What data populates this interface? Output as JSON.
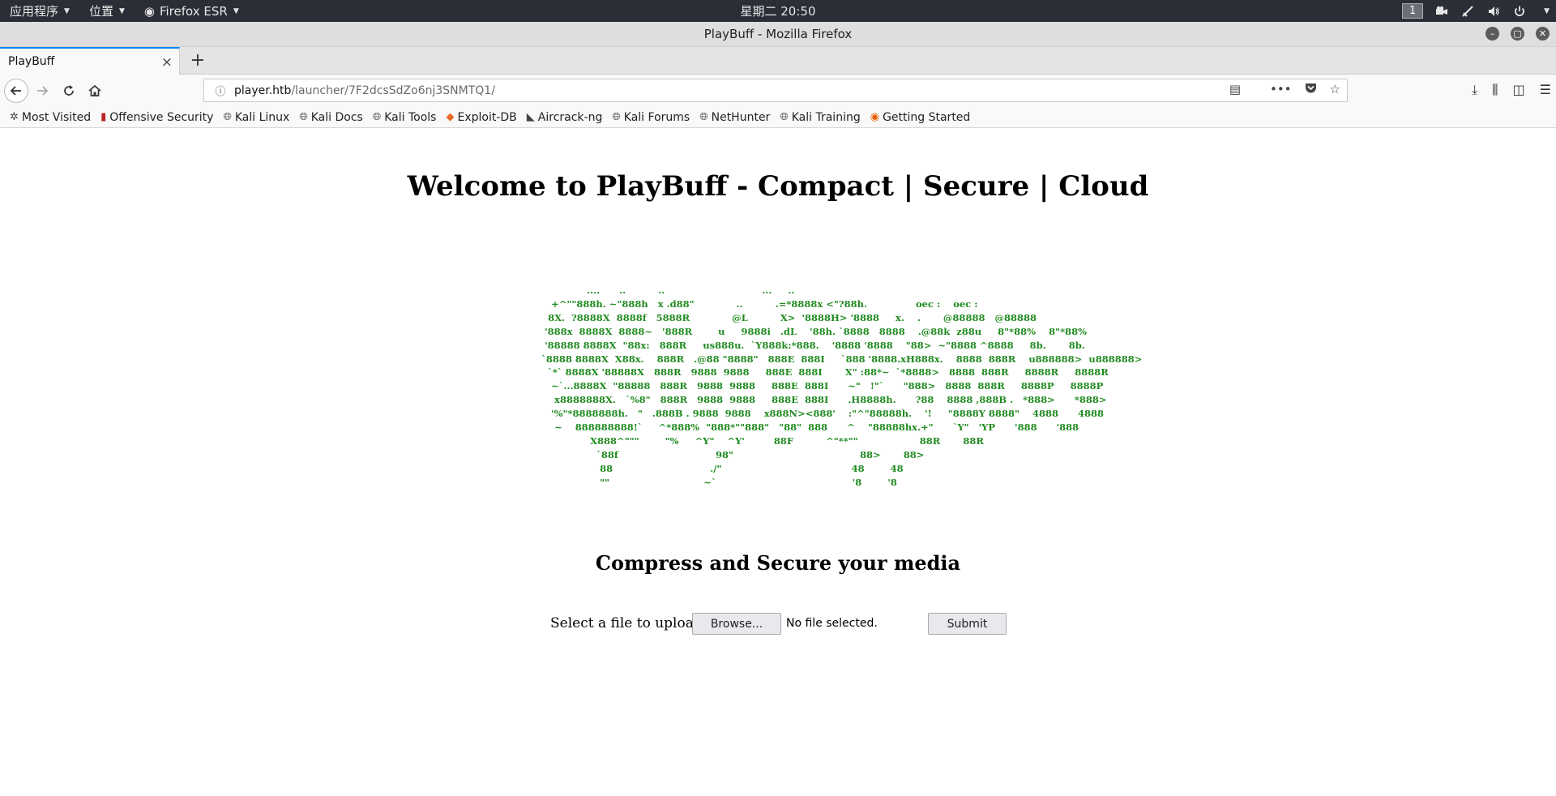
{
  "desktop": {
    "applications_label": "应用程序",
    "places_label": "位置",
    "active_app_label": "Firefox ESR",
    "clock": "星期二 20:50",
    "workspace_number": "1"
  },
  "window": {
    "title": "PlayBuff - Mozilla Firefox"
  },
  "tabs": [
    {
      "label": "PlayBuff",
      "active": true
    }
  ],
  "urlbar": {
    "host": "player.htb",
    "path": "/launcher/7F2dcsSdZo6nj3SNMTQ1/"
  },
  "bookmarks": [
    {
      "label": "Most Visited",
      "icon": "gear-icon"
    },
    {
      "label": "Offensive Security",
      "icon": "offsec-icon"
    },
    {
      "label": "Kali Linux",
      "icon": "globe-icon"
    },
    {
      "label": "Kali Docs",
      "icon": "globe-icon"
    },
    {
      "label": "Kali Tools",
      "icon": "globe-icon"
    },
    {
      "label": "Exploit-DB",
      "icon": "exploitdb-icon"
    },
    {
      "label": "Aircrack-ng",
      "icon": "aircrack-icon"
    },
    {
      "label": "Kali Forums",
      "icon": "globe-icon"
    },
    {
      "label": "NetHunter",
      "icon": "globe-icon"
    },
    {
      "label": "Kali Training",
      "icon": "globe-icon"
    },
    {
      "label": "Getting Started",
      "icon": "firefox-icon"
    }
  ],
  "page": {
    "title": "Welcome to PlayBuff - Compact | Secure | Cloud",
    "ascii_art": "                                 ....      ..          ..                              ...     ..\n                      +^\"\"888h. ~\"888h   x .d88\"             ..          .=*8888x <\"?88h.               oec :    oec :\n                     8X.  ?8888X  8888f   5888R             @L          X>  '8888H> '8888     x.    .       @88888   @88888\n                    '888x  8888X  8888~   '888R        u     9888i   .dL    '88h. `8888   8888    .@88k  z88u     8\"*88%    8\"*88%\n                    '88888 8888X  \"88x:   888R     us888u.  `Y888k:*888.    '8888 '8888    \"88>  ~\"8888 ^8888     8b.       8b.\n                   `8888 8888X  X88x.    888R   .@88 \"8888\"   888E  888I     `888 '8888.xH888x.    8888  888R    u888888>  u888888>\n                     `*` 8888X '88888X   888R   9888  9888     888E  888I       X\" :88*~  `*8888>   8888  888R     8888R     8888R\n                      ~`...8888X  \"88888   888R   9888  9888     888E  888I      ~\"   !\"`      \"888>   8888  888R     8888P     8888P\n                       x8888888X.   `%8\"   888R   9888  9888     888E  888I      .H8888h.      ?88    8888 ,888B .   *888>      *888>\n                      '%\"*8888888h.   \"   .888B . 9888  9888    x888N><888'    :\"^\"88888h.    '!     \"8888Y 8888\"    4888      4888\n                       ~    888888888!`     ^*888%  \"888*\"\"888\"   \"88\"  888      ^    \"88888hx.+\"      `Y\"   'YP      '888      '888\n                                  X888^\"\"\"        \"%     ^Y\"    ^Y'         88F          ^\"**\"\"                   88R       88R\n                                    `88f                              98\"                                       88>       88>\n                                     88                              ./\"                                        48        48\n                                     \"\"                             ~`                                          '8        '8",
    "subtitle": "Compress and Secure your media",
    "upload_label": "Select a file to upload",
    "browse_label": "Browse...",
    "no_file_label": "No file selected.",
    "submit_label": "Submit"
  }
}
